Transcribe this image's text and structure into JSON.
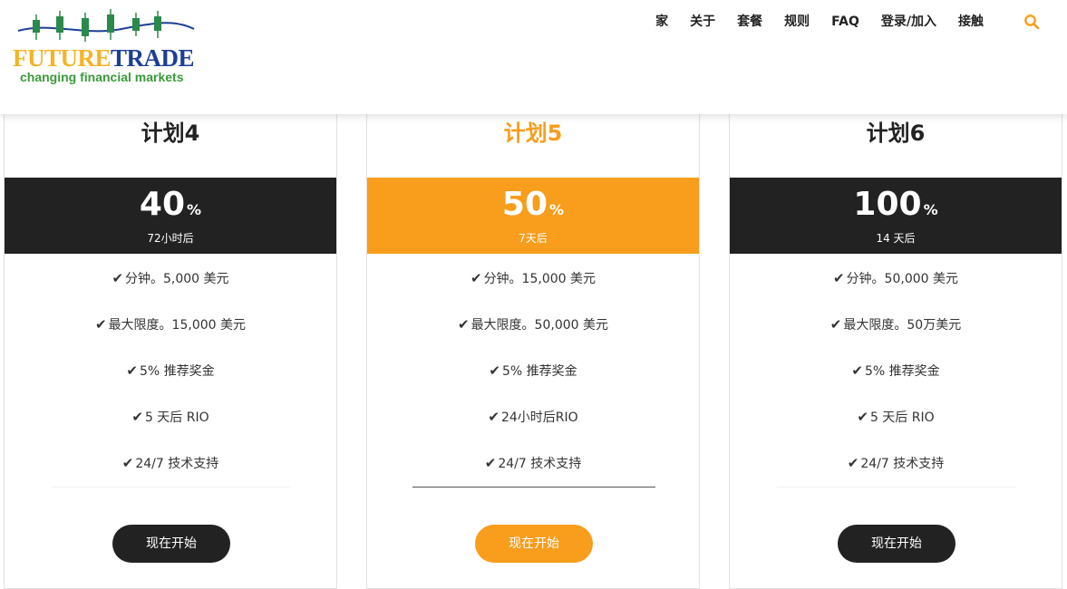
{
  "header": {
    "logo": {
      "word1": "FUTURE",
      "word2": "TRADE",
      "tagline": "changing financial markets"
    },
    "nav": [
      "家",
      "关于",
      "套餐",
      "规则",
      "FAQ",
      "登录/加入",
      "接触"
    ],
    "search_icon": "search-icon"
  },
  "colors": {
    "accent": "#f89d1c",
    "dark": "#222222",
    "logo_yellow": "#f5b324",
    "logo_blue": "#1c3f95",
    "logo_green": "#3a9a3a"
  },
  "plans": [
    {
      "title": "计划4",
      "percent": "40",
      "unit": "%",
      "after": "72小时后",
      "features": [
        "分钟。5,000 美元",
        "最大限度。15,000 美元",
        "5% 推荐奖金",
        "5 天后 RIO",
        "24/7 技术支持"
      ],
      "button": "现在开始"
    },
    {
      "title": "计划5",
      "percent": "50",
      "unit": "%",
      "after": "7天后",
      "features": [
        "分钟。15,000 美元",
        "最大限度。50,000 美元",
        "5% 推荐奖金",
        "24小时后RIO",
        "24/7 技术支持"
      ],
      "button": "现在开始"
    },
    {
      "title": "计划6",
      "percent": "100",
      "unit": "%",
      "after": "14 天后",
      "features": [
        "分钟。50,000 美元",
        "最大限度。50万美元",
        "5% 推荐奖金",
        "5 天后 RIO",
        "24/7 技术支持"
      ],
      "button": "现在开始"
    }
  ]
}
